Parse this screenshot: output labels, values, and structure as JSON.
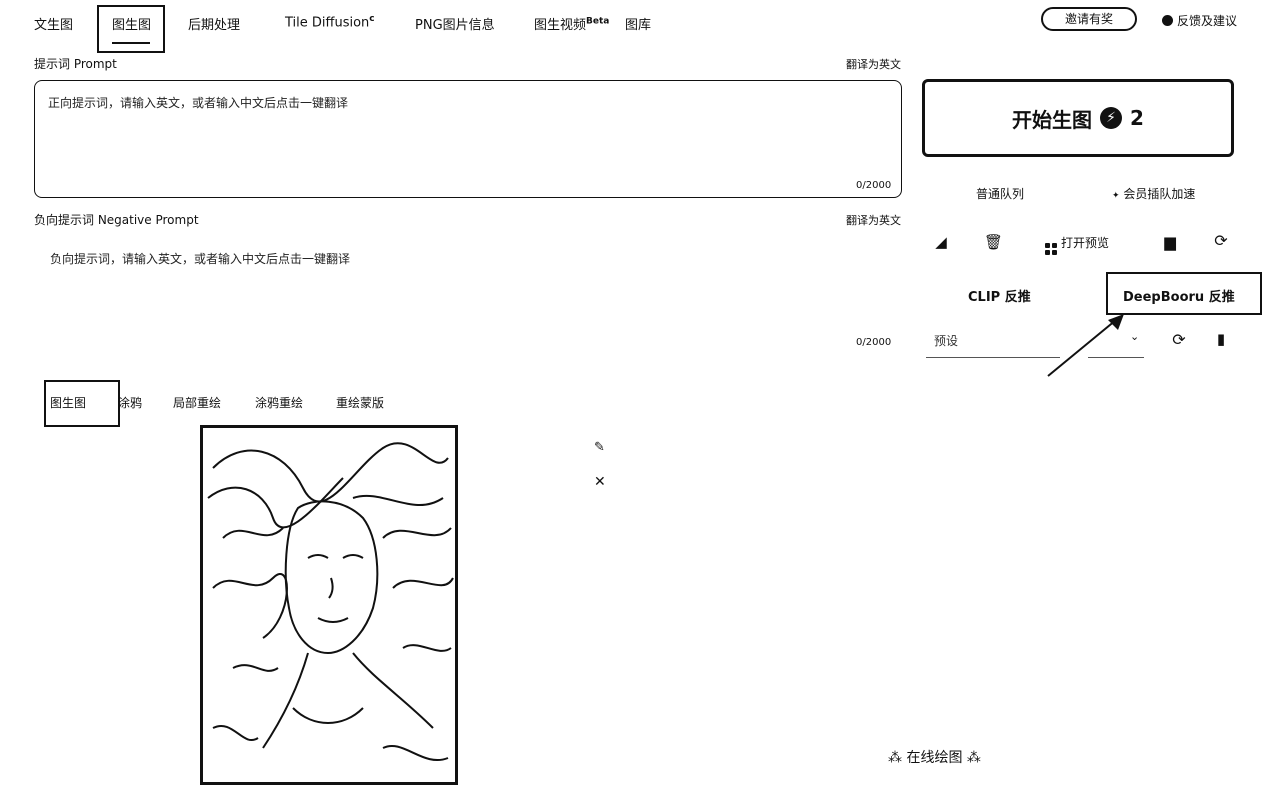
{
  "nav": {
    "tabs": [
      "文生图",
      "图生图",
      "后期处理",
      "Tile Diffusion",
      "PNG图片信息",
      "图生视频",
      "图库"
    ],
    "tab3_sup": "c",
    "tab5_sup": "Beta",
    "pill_label": "邀请有奖",
    "feedback": "反馈及建议"
  },
  "prompt": {
    "label": "提示词  Prompt",
    "translate": "翻译为英文",
    "placeholder": "正向提示词，请输入英文，或者输入中文后点击一键翻译",
    "counter": "0/2000"
  },
  "negative": {
    "label": "负向提示词  Negative Prompt",
    "translate": "翻译为英文",
    "placeholder": "负向提示词，请输入英文，或者输入中文后点击一键翻译",
    "counter": "0/2000"
  },
  "right": {
    "generate": "开始生图",
    "cost": "2",
    "queue_normal": "普通队列",
    "queue_vip": "会员插队加速",
    "open_preview": "打开预览",
    "clip": "CLIP 反推",
    "deepbooru": "DeepBooru 反推",
    "preset": "预设"
  },
  "subtabs": [
    "图生图",
    "涂鸦",
    "局部重绘",
    "涂鸦重绘",
    "重绘蒙版"
  ],
  "footer": {
    "online": "在线绘图"
  },
  "icons": [
    "brush-icon",
    "trash-icon",
    "grid-icon",
    "folder-icon",
    "refresh-icon",
    "pencil-icon",
    "close-icon",
    "file-icon",
    "sparkle-icon"
  ]
}
